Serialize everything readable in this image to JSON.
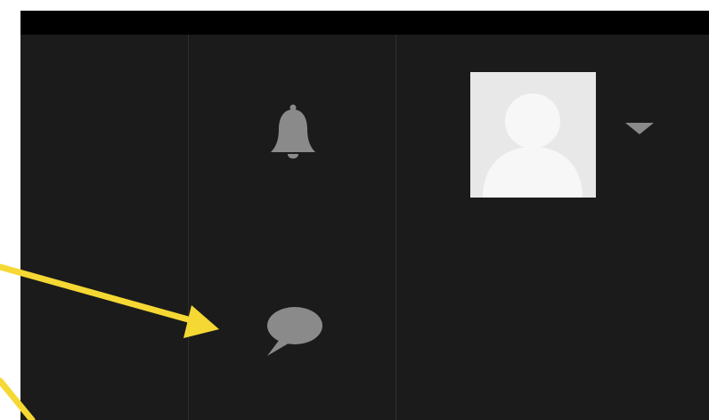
{
  "header": {
    "notifications_icon": "bell-icon",
    "messages_icon": "speech-bubble-icon",
    "user_menu": {
      "avatar_icon": "default-user-avatar",
      "dropdown_icon": "caret-down-icon"
    }
  },
  "annotation": {
    "arrow_color": "#f5d833",
    "target": "messages-button"
  },
  "colors": {
    "background": "#1b1b1b",
    "top_strip": "#000000",
    "icon": "#8a8a8a",
    "avatar_bg": "#e8e8e8",
    "avatar_figure": "#f7f7f7"
  }
}
